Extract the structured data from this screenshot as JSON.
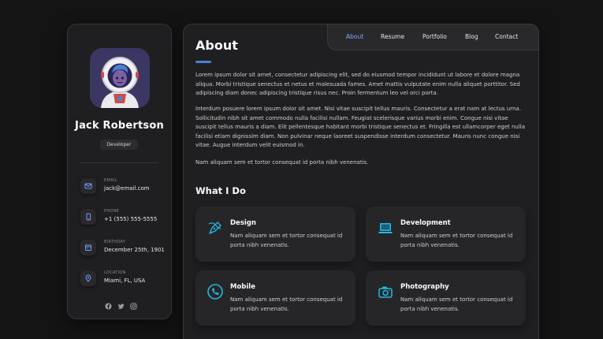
{
  "profile": {
    "name": "Jack Robertson",
    "role": "Developer",
    "contacts": [
      {
        "label": "EMAIL",
        "value": "jack@email.com",
        "icon": "mail-icon"
      },
      {
        "label": "PHONE",
        "value": "+1 (555) 555-5555",
        "icon": "phone-icon"
      },
      {
        "label": "BIRTHDAY",
        "value": "December 25th, 1901",
        "icon": "calendar-icon"
      },
      {
        "label": "LOCATION",
        "value": "Miami, FL, USA",
        "icon": "location-pin-icon"
      }
    ],
    "socials": [
      "facebook-icon",
      "twitter-icon",
      "instagram-icon"
    ]
  },
  "nav": {
    "items": [
      "About",
      "Resume",
      "Portfolio",
      "Blog",
      "Contact"
    ],
    "active": "About"
  },
  "about": {
    "title": "About",
    "paragraphs": [
      "Lorem ipsum dolor sit amet, consectetur adipiscing elit, sed do eiusmod tempor incididunt ut labore et dolore magna aliqua. Morbi tristique senectus et netus et malesuada fames. Amet mattis vulputate enim nulla aliquet porttitor. Sed adipiscing diam donec adipiscing tristique risus nec. Proin fermentum leo vel orci porta.",
      "Interdum posuere lorem ipsum dolor sit amet. Nisi vitae suscipit tellus mauris. Consectetur a erat nam at lectus urna. Sollicitudin nibh sit amet commodo nulla facilisi nullam. Feugiat scelerisque varius morbi enim. Congue nisi vitae suscipit tellus mauris a diam. Elit pellentesque habitant morbi tristique senectus et. Fringilla est ullamcorper eget nulla facilisi etiam dignissim diam. Non pulvinar neque laoreet suspendisse interdum consectetur. Mauris nunc congue nisi vitae. Augue interdum velit euismod in.",
      "Nam aliquam sem et tortor consequat id porta nibh venenatis."
    ]
  },
  "services": {
    "title": "What I Do",
    "items": [
      {
        "title": "Design",
        "desc": "Nam aliquam sem et tortor consequat id porta nibh venenatis.",
        "icon": "design-pen-icon"
      },
      {
        "title": "Development",
        "desc": "Nam aliquam sem et tortor consequat id porta nibh venenatis.",
        "icon": "laptop-icon"
      },
      {
        "title": "Mobile",
        "desc": "Nam aliquam sem et tortor consequat id porta nibh venenatis.",
        "icon": "phone-call-icon"
      },
      {
        "title": "Photography",
        "desc": "Nam aliquam sem et tortor consequat id porta nibh venenatis.",
        "icon": "camera-icon"
      }
    ]
  },
  "colors": {
    "background": "#141414",
    "card": "#1f1f21",
    "accent": "#4f7fd6",
    "nav_active": "#8aa6ff",
    "icon_cyan": "#22b8e0"
  }
}
